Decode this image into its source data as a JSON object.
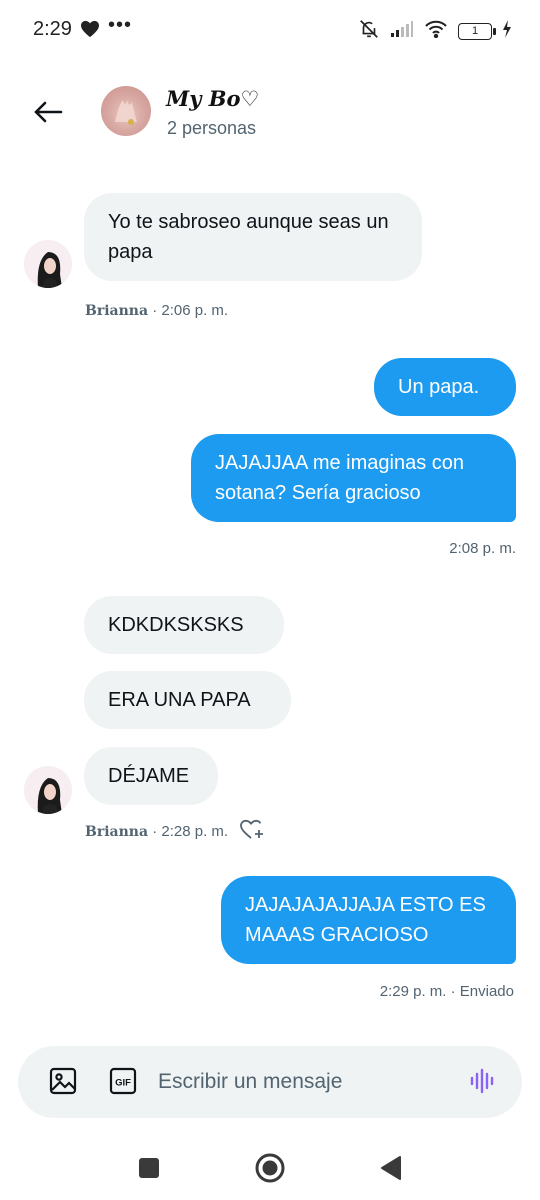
{
  "status_bar": {
    "time": "2:29",
    "battery": "1",
    "icons": [
      "heart-icon",
      "more-dots-icon",
      "bell-off-icon",
      "signal-icon",
      "wifi-icon",
      "battery-icon",
      "charging-icon"
    ]
  },
  "header": {
    "title": "My Bo♡",
    "subtitle": "2 personas",
    "back_icon": "arrow-left-icon"
  },
  "messages": [
    {
      "side": "in",
      "text": "Yo te sabroseo aunque seas un papa"
    },
    {
      "side": "in_meta",
      "sender": "Brianna",
      "time": " · 2:06 p. m."
    },
    {
      "side": "out",
      "text": "Un papa."
    },
    {
      "side": "out",
      "text": "JAJAJJAA me imaginas con sotana? Sería gracioso"
    },
    {
      "side": "out_meta",
      "time": "2:08 p. m."
    },
    {
      "side": "in",
      "text": "KDKDKSKSKS"
    },
    {
      "side": "in",
      "text": "ERA UNA PAPA"
    },
    {
      "side": "in",
      "text": "DÉJAME"
    },
    {
      "side": "in_meta",
      "sender": "Brianna",
      "time": " · 2:28 p. m."
    },
    {
      "side": "out",
      "text": "JAJAJAJAJJAJA ESTO ES MAAAS GRACIOSO"
    },
    {
      "side": "out_meta",
      "time": "2:29 p. m. · Enviado"
    }
  ],
  "composer": {
    "placeholder": "Escribir un mensaje",
    "icons": [
      "image-icon",
      "gif-icon",
      "voice-icon"
    ],
    "gif_label": "GIF"
  },
  "nav": {
    "icons": [
      "recents-square-icon",
      "home-circle-icon",
      "back-triangle-icon"
    ]
  },
  "colors": {
    "accent": "#1d9bf0",
    "incoming_bubble": "#eff3f4",
    "secondary_text": "#536471",
    "voice_icon": "#8a63f5"
  }
}
